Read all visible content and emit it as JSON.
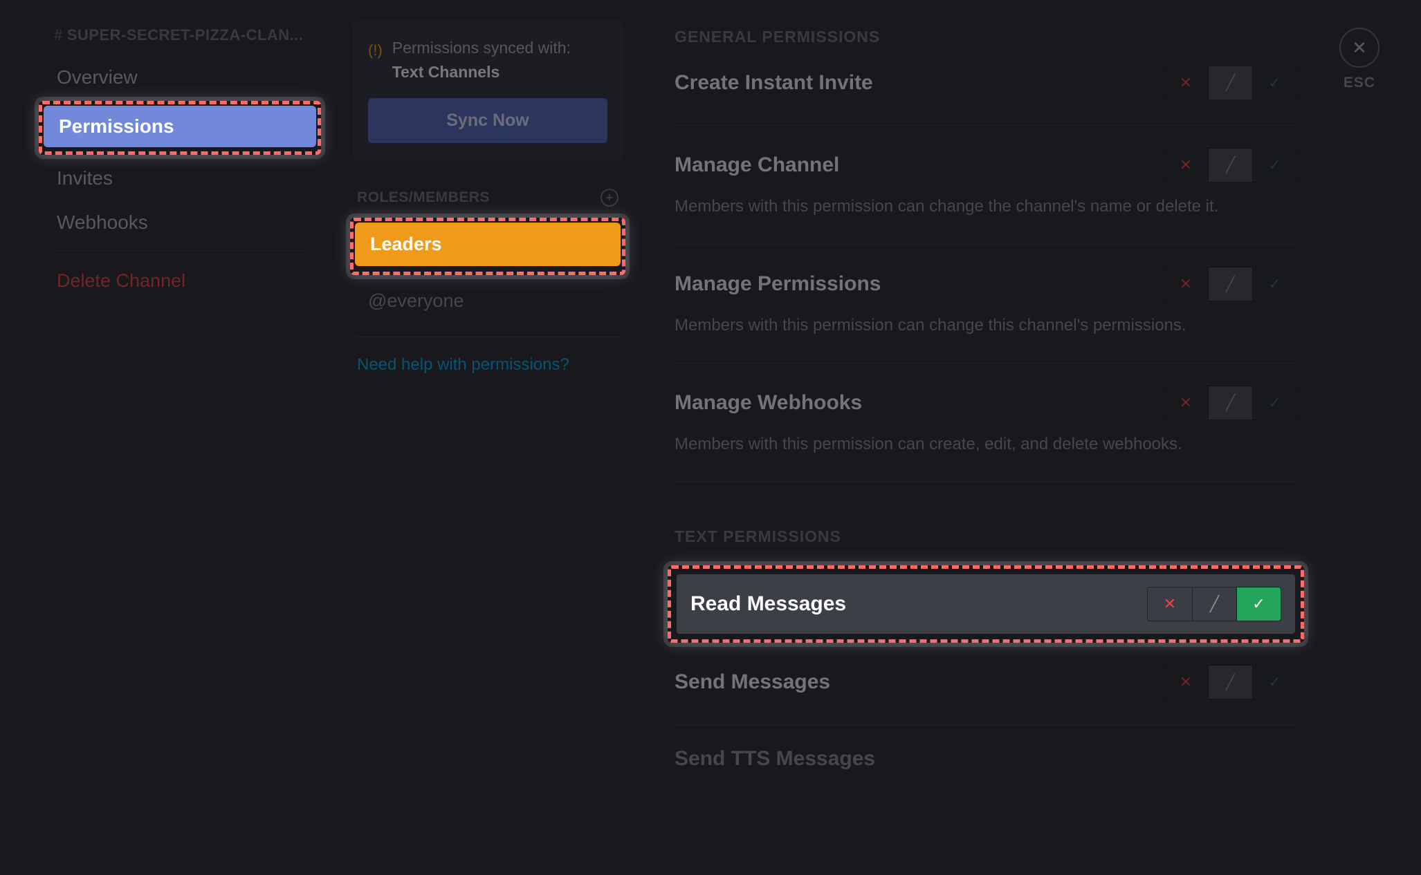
{
  "channel": {
    "name": "SUPER-SECRET-PIZZA-CLAN...",
    "hash": "#"
  },
  "sidebar": {
    "items": [
      {
        "label": "Overview"
      },
      {
        "label": "Permissions"
      },
      {
        "label": "Invites"
      },
      {
        "label": "Webhooks"
      }
    ],
    "delete_label": "Delete Channel"
  },
  "sync_card": {
    "line1": "Permissions synced with:",
    "category": "Text Channels",
    "button": "Sync Now"
  },
  "roles": {
    "heading": "ROLES/MEMBERS",
    "items": [
      {
        "label": "Leaders"
      },
      {
        "label": "@everyone"
      }
    ],
    "help": "Need help with permissions?"
  },
  "sections": {
    "general": {
      "heading": "GENERAL PERMISSIONS",
      "perms": [
        {
          "title": "Create Instant Invite",
          "desc": "",
          "state": "pass"
        },
        {
          "title": "Manage Channel",
          "desc": "Members with this permission can change the channel's name or delete it.",
          "state": "pass"
        },
        {
          "title": "Manage Permissions",
          "desc": "Members with this permission can change this channel's permissions.",
          "state": "pass"
        },
        {
          "title": "Manage Webhooks",
          "desc": "Members with this permission can create, edit, and delete webhooks.",
          "state": "pass"
        }
      ]
    },
    "text": {
      "heading": "TEXT PERMISSIONS",
      "perms": [
        {
          "title": "Read Messages",
          "state": "allow",
          "highlight": true
        },
        {
          "title": "Send Messages",
          "state": "pass"
        },
        {
          "title": "Send TTS Messages",
          "state": "pass",
          "cut": true
        }
      ]
    }
  },
  "close": {
    "esc": "ESC",
    "x": "✕"
  },
  "icons": {
    "deny": "✕",
    "pass": "╱",
    "allow": "✓",
    "warn": "(!)",
    "plus": "+"
  }
}
